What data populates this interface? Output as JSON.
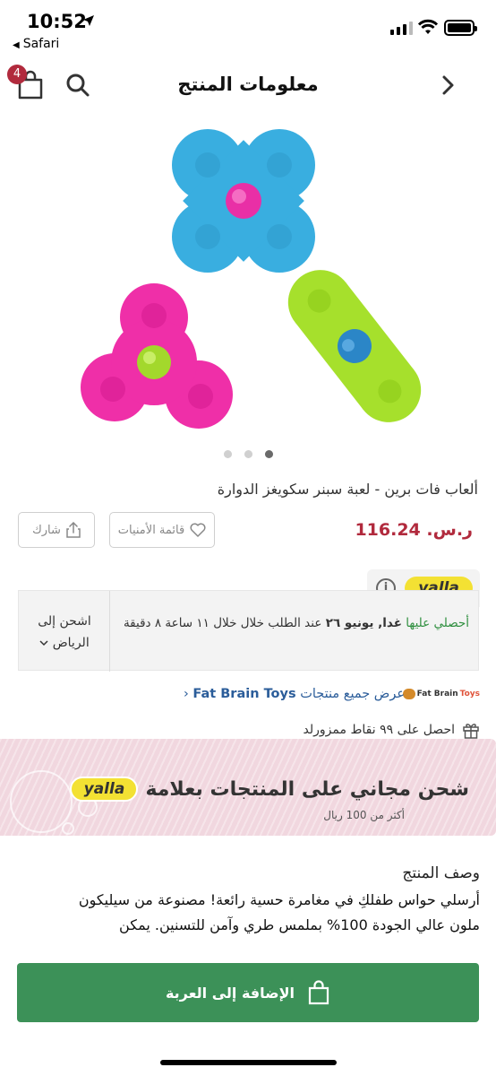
{
  "status_bar": {
    "time": "10:52",
    "back_app": "Safari"
  },
  "header": {
    "title": "معلومات المنتج",
    "cart_count": "4"
  },
  "product": {
    "image_alt": "Fat Brain Toys Squigz Spinner",
    "carousel": {
      "count": 3,
      "active": 3
    },
    "title": "ألعاب فات برين - لعبة سبنر سكويغز الدوارة",
    "price": "116.24",
    "currency": "ر.س.",
    "wishlist_label": "قائمة الأمنيات",
    "share_label": "شارك"
  },
  "delivery": {
    "badge": "yalla",
    "green_text": "أحصلي عليها",
    "bold_text": "غدا, يونيو ٢٦",
    "rest_text": "عند الطلب خلال خلال ١١ ساعة ٨ دقيقة",
    "ship_to_label": "اشحن إلى",
    "city": "الرياض"
  },
  "brand": {
    "link_prefix": "عرض جميع منتجات",
    "name": "Fat Brain Toys",
    "logo_text_a": "Fat Brain",
    "logo_text_b": "Toys"
  },
  "points": {
    "text": "احصل على ٩٩ نقاط ممزورلد"
  },
  "banner": {
    "title": "شحن مجاني على المنتجات بعلامة",
    "badge": "yalla",
    "subtitle": "أكثر من 100 ريال"
  },
  "description": {
    "heading": "وصف المنتج",
    "line1": "أرسلي حواس طفلكِ في مغامرة حسية رائعة! مصنوعة من سيليكون",
    "line2": "ملون عالي الجودة 100% بملمس طري وآمن للتسنين. يمكن"
  },
  "cart_button": {
    "label": "الإضافة إلى العربة"
  },
  "colors": {
    "accent": "#b12a3d",
    "green": "#3c9158",
    "link": "#2b5d9a",
    "yalla": "#f3e133"
  }
}
